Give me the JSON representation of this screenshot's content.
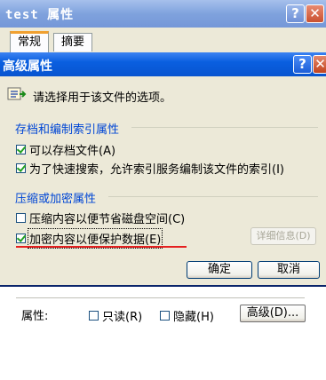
{
  "back_window": {
    "title": "test 属性",
    "help_glyph": "?",
    "close_glyph": "✕",
    "tabs": [
      "常规",
      "摘要"
    ],
    "attributes": {
      "label": "属性:",
      "readonly_label": "只读(R)",
      "readonly_checked": false,
      "hidden_label": "隐藏(H)",
      "hidden_checked": false,
      "advanced_button": "高级(D)..."
    }
  },
  "dialog": {
    "title": "高级属性",
    "help_glyph": "?",
    "close_glyph": "✕",
    "intro": "请选择用于该文件的选项。",
    "archive_group": {
      "label": "存档和编制索引属性",
      "options": [
        {
          "label": "可以存档文件(A)",
          "checked": true
        },
        {
          "label": "为了快速搜索，允许索引服务编制该文件的索引(I)",
          "checked": true
        }
      ]
    },
    "compress_group": {
      "label": "压缩或加密属性",
      "options": [
        {
          "label": "压缩内容以便节省磁盘空间(C)",
          "checked": false
        },
        {
          "label": "加密内容以便保护数据(E)",
          "checked": true
        }
      ],
      "details_button": "详细信息(D)"
    },
    "ok_button": "确定",
    "cancel_button": "取消"
  },
  "colors": {
    "titlebar_active": "#0a5fe0",
    "titlebar_inactive": "#7fa2dd",
    "group_label": "#0046d5",
    "highlight_underline": "#e52020",
    "dialog_bg": "#ece9d8"
  },
  "icons": [
    "folder-options-icon",
    "help-icon",
    "close-icon",
    "checkmark-icon"
  ]
}
